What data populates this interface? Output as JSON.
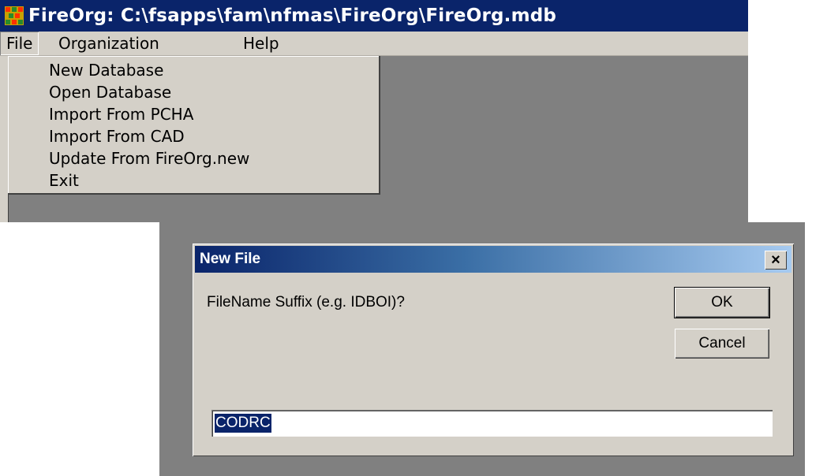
{
  "app": {
    "title": "FireOrg: C:\\fsapps\\fam\\nfmas\\FireOrg\\FireOrg.mdb",
    "icon": "fireorg-app-icon"
  },
  "menubar": {
    "items": [
      {
        "label": "File"
      },
      {
        "label": "Organization"
      },
      {
        "label": "Help"
      }
    ]
  },
  "file_menu": {
    "items": [
      {
        "label": "New Database"
      },
      {
        "label": "Open Database"
      },
      {
        "label": "Import From PCHA"
      },
      {
        "label": "Import From CAD"
      },
      {
        "label": "Update From FireOrg.new"
      },
      {
        "label": "Exit"
      }
    ]
  },
  "dialog": {
    "title": "New File",
    "close_label": "×",
    "prompt": "FileName Suffix (e.g. IDBOI)?",
    "ok_label": "OK",
    "cancel_label": "Cancel",
    "input_value": "CODRC"
  },
  "colors": {
    "title_bar": "#0a246a",
    "face": "#d4d0c8",
    "workspace": "#808080"
  }
}
